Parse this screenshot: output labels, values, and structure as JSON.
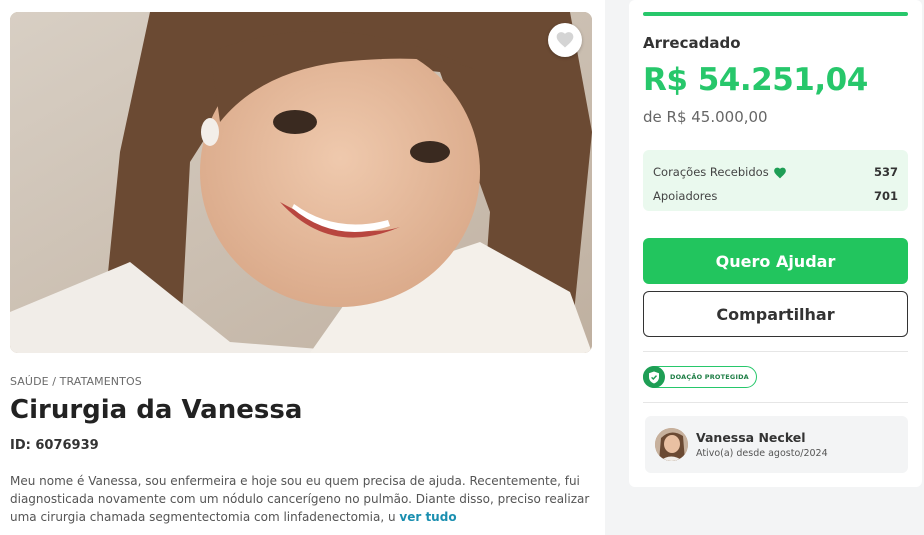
{
  "campaign": {
    "category": "SAÚDE / TRATAMENTOS",
    "title": "Cirurgia da Vanessa",
    "id_label": "ID: 6076939",
    "story": "Meu nome é Vanessa, sou enfermeira e hoje sou eu quem precisa de ajuda. Recentemente, fui diagnosticada novamente com um nódulo cancerígeno no pulmão. Diante disso, preciso realizar uma cirurgia chamada segmentectomia com linfadenectomia, u",
    "read_more": "ver tudo",
    "favorite_icon": "heart-icon"
  },
  "donation": {
    "raised_label": "Arrecadado",
    "raised_amount": "R$ 54.251,04",
    "goal": "de R$ 45.000,00",
    "progress_fraction": 1.0,
    "accent_color": "#27c76b",
    "stats": [
      {
        "label": "Corações Recebidos",
        "value": "537",
        "icon": "heart-icon"
      },
      {
        "label": "Apoiadores",
        "value": "701"
      }
    ],
    "help_button": "Quero Ajudar",
    "share_button": "Compartilhar",
    "protected_badge": "DOAÇÃO PROTEGIDA"
  },
  "author": {
    "name": "Vanessa Neckel",
    "since": "Ativo(a) desde agosto/2024"
  }
}
